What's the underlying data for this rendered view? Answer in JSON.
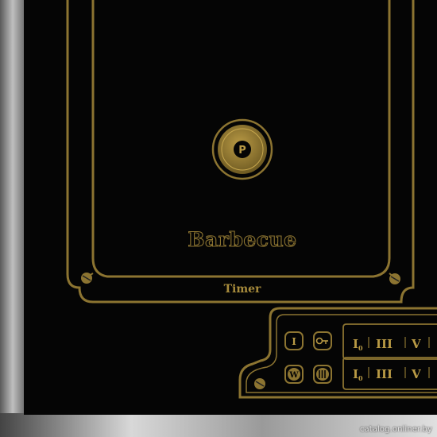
{
  "cooktop": {
    "zone_label": "Barbecue",
    "timer_label": "Timer",
    "power_button_symbol": "P",
    "colors": {
      "glass": "#050505",
      "trim": "#8c7431",
      "trim_light": "#b99a45",
      "steel_dark": "#4a4a4a",
      "steel_light": "#c9c9c9"
    },
    "controls": {
      "buttons": [
        {
          "symbol": "I",
          "icon": "power-on-off-icon"
        },
        {
          "symbol": "⊙",
          "icon": "key-lock-icon"
        },
        {
          "symbol": "W",
          "icon": "warming-w-icon"
        },
        {
          "symbol": "|||",
          "icon": "boost-icon"
        }
      ],
      "slider_rows": [
        {
          "marks": [
            "I",
            "0",
            "III",
            "V"
          ]
        },
        {
          "marks": [
            "I",
            "0",
            "III",
            "V"
          ]
        }
      ]
    }
  },
  "watermark": "catalog.onliner.by"
}
